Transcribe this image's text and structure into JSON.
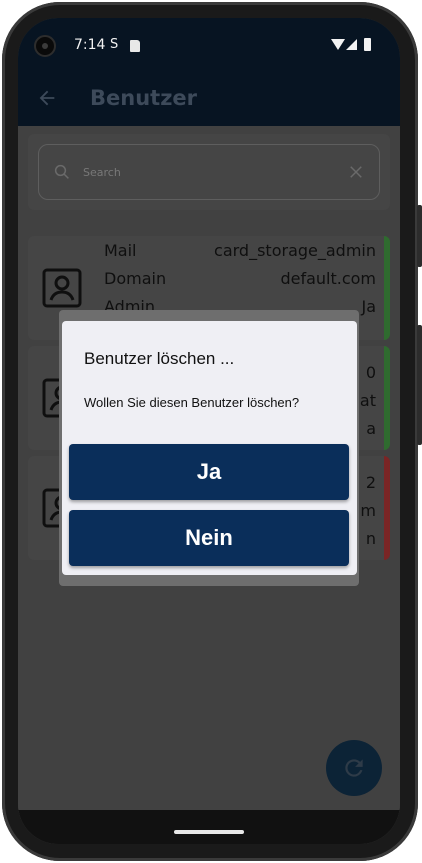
{
  "status_bar": {
    "time": "7:14",
    "s_icon": "S"
  },
  "app_bar": {
    "title": "Benutzer",
    "back_icon": "arrow-left-icon"
  },
  "search": {
    "placeholder": "Search",
    "value": ""
  },
  "users": [
    {
      "rows": [
        {
          "label": "Mail",
          "value": "card_storage_admin"
        },
        {
          "label": "Domain",
          "value": "default.com"
        },
        {
          "label": "Admin",
          "value": "Ja"
        }
      ],
      "status_color": "#2f6b2f"
    },
    {
      "rows": [
        {
          "label": "",
          "value": "0"
        },
        {
          "label": "",
          "value": "at"
        },
        {
          "label": "",
          "value": "a"
        }
      ],
      "status_color": "#2f6b2f"
    },
    {
      "rows": [
        {
          "label": "",
          "value": "2"
        },
        {
          "label": "",
          "value": "m"
        },
        {
          "label": "",
          "value": "n"
        }
      ],
      "status_color": "#7a2525"
    }
  ],
  "dialog": {
    "title": "Benutzer löschen ...",
    "message": "Wollen Sie diesen Benutzer löschen?",
    "yes_label": "Ja",
    "no_label": "Nein"
  },
  "fab": {
    "icon": "refresh-icon"
  },
  "colors": {
    "primary": "#0a2e5a",
    "appbar": "#071422",
    "scrim": "#414141"
  }
}
